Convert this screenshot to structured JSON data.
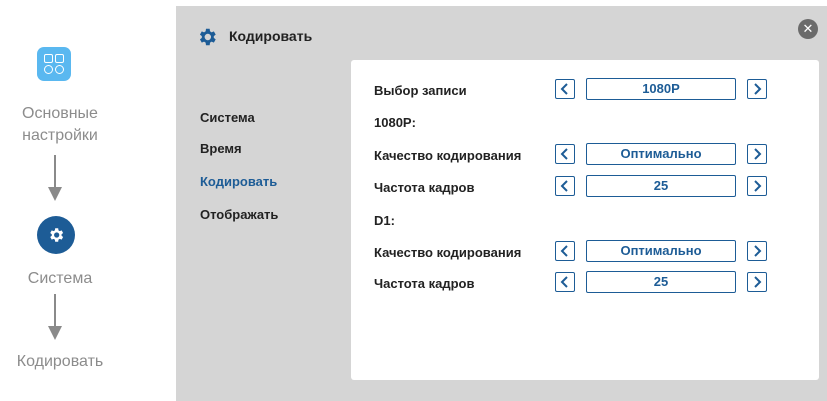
{
  "flow": {
    "step1_label_line1": "Основные",
    "step1_label_line2": "настройки",
    "step2_label": "Система",
    "step3_label": "Кодировать"
  },
  "window": {
    "title": "Кодировать",
    "close_glyph": "✕"
  },
  "nav": {
    "items": [
      {
        "label": "Система",
        "active": false
      },
      {
        "label": "Время",
        "active": false
      },
      {
        "label": "Кодировать",
        "active": true
      },
      {
        "label": "Отображать",
        "active": false
      }
    ]
  },
  "settings": {
    "record_select_label": "Выбор записи",
    "record_select_value": "1080P",
    "section_1080p": "1080P:",
    "q1_label": "Качество кодирования",
    "q1_value": "Оптимально",
    "f1_label": "Частота кадров",
    "f1_value": "25",
    "section_d1": "D1:",
    "q2_label": "Качество кодирования",
    "q2_value": "Оптимально",
    "f2_label": "Частота кадров",
    "f2_value": "25"
  },
  "colors": {
    "accent": "#1d5c96",
    "apps_icon": "#5ab8f0",
    "window_bg": "#d5d5d5",
    "muted_text": "#8c8c8c"
  },
  "icons": {
    "apps": "apps-grid-icon",
    "gear": "gear-icon",
    "arrow_down": "arrow-down-icon",
    "close": "close-icon",
    "prev": "chevron-left-icon",
    "next": "chevron-right-icon"
  }
}
